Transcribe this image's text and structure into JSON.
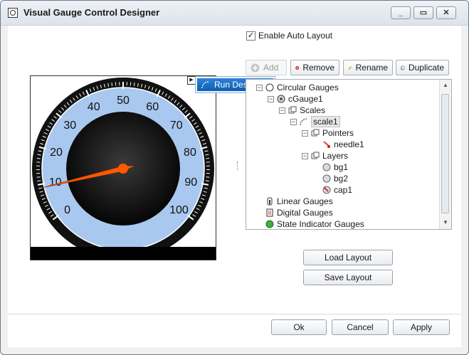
{
  "window": {
    "title": "Visual Gauge Control Designer"
  },
  "options": {
    "enable_auto_layout_label": "Enable Auto Layout",
    "enable_auto_layout_checked": true
  },
  "toolbar": {
    "add": "Add",
    "remove": "Remove",
    "rename": "Rename",
    "duplicate": "Duplicate"
  },
  "popup": {
    "run_designer": "Run Designer"
  },
  "gauge": {
    "scale_labels": [
      "0",
      "10",
      "20",
      "30",
      "40",
      "50",
      "60",
      "70",
      "80",
      "90",
      "100"
    ],
    "needle_value": 9,
    "colors": {
      "scale_fill": "#a9c8ef",
      "bezel": "#111111",
      "needle": "#ff5a00",
      "ticks": "#ffffff"
    }
  },
  "tree": {
    "nodes": [
      {
        "label": "Circular Gauges",
        "level": 0,
        "expander": "−",
        "icon": "circular-gauges-icon"
      },
      {
        "label": "cGauge1",
        "level": 1,
        "expander": "−",
        "icon": "circular-gauge-icon"
      },
      {
        "label": "Scales",
        "level": 2,
        "expander": "−",
        "icon": "folder-icon"
      },
      {
        "label": "scale1",
        "level": 3,
        "expander": "−",
        "icon": "arc-scale-icon",
        "selected": true
      },
      {
        "label": "Pointers",
        "level": 4,
        "expander": "−",
        "icon": "folder-icon"
      },
      {
        "label": "needle1",
        "level": 5,
        "expander": "",
        "icon": "needle-icon"
      },
      {
        "label": "Layers",
        "level": 4,
        "expander": "−",
        "icon": "folder-icon"
      },
      {
        "label": "bg1",
        "level": 5,
        "expander": "",
        "icon": "layer-icon"
      },
      {
        "label": "bg2",
        "level": 5,
        "expander": "",
        "icon": "layer-icon"
      },
      {
        "label": "cap1",
        "level": 5,
        "expander": "",
        "icon": "cap-icon"
      },
      {
        "label": "Linear Gauges",
        "level": 0,
        "expander": "",
        "icon": "linear-gauge-icon"
      },
      {
        "label": "Digital Gauges",
        "level": 0,
        "expander": "",
        "icon": "digital-gauge-icon"
      },
      {
        "label": "State Indicator Gauges",
        "level": 0,
        "expander": "",
        "icon": "state-indicator-icon"
      }
    ]
  },
  "layout_buttons": {
    "load": "Load Layout",
    "save": "Save Layout"
  },
  "footer": {
    "ok": "Ok",
    "cancel": "Cancel",
    "apply": "Apply"
  }
}
